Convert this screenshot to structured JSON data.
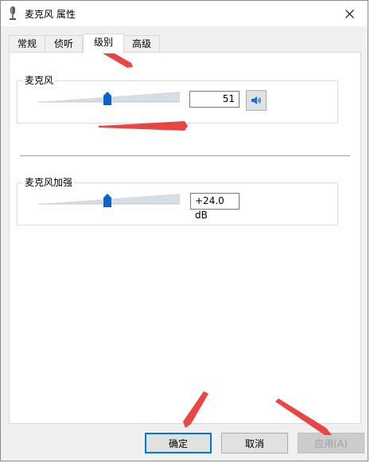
{
  "window": {
    "title": "麦克风 属性",
    "close_icon": "close-icon",
    "mic_icon": "microphone-icon"
  },
  "tabs": [
    {
      "label": "常规",
      "active": false
    },
    {
      "label": "侦听",
      "active": false
    },
    {
      "label": "级别",
      "active": true
    },
    {
      "label": "高级",
      "active": false
    }
  ],
  "levels": {
    "microphone": {
      "label": "麦克风",
      "value": "51",
      "speaker_icon": "speaker-icon"
    },
    "boost": {
      "label": "麦克风加强",
      "value": "+24.0 dB"
    }
  },
  "buttons": {
    "ok": "确定",
    "cancel": "取消",
    "apply": "应用(A)"
  },
  "colors": {
    "accent": "#0078d7",
    "annotation_arrow": "#e84545"
  }
}
